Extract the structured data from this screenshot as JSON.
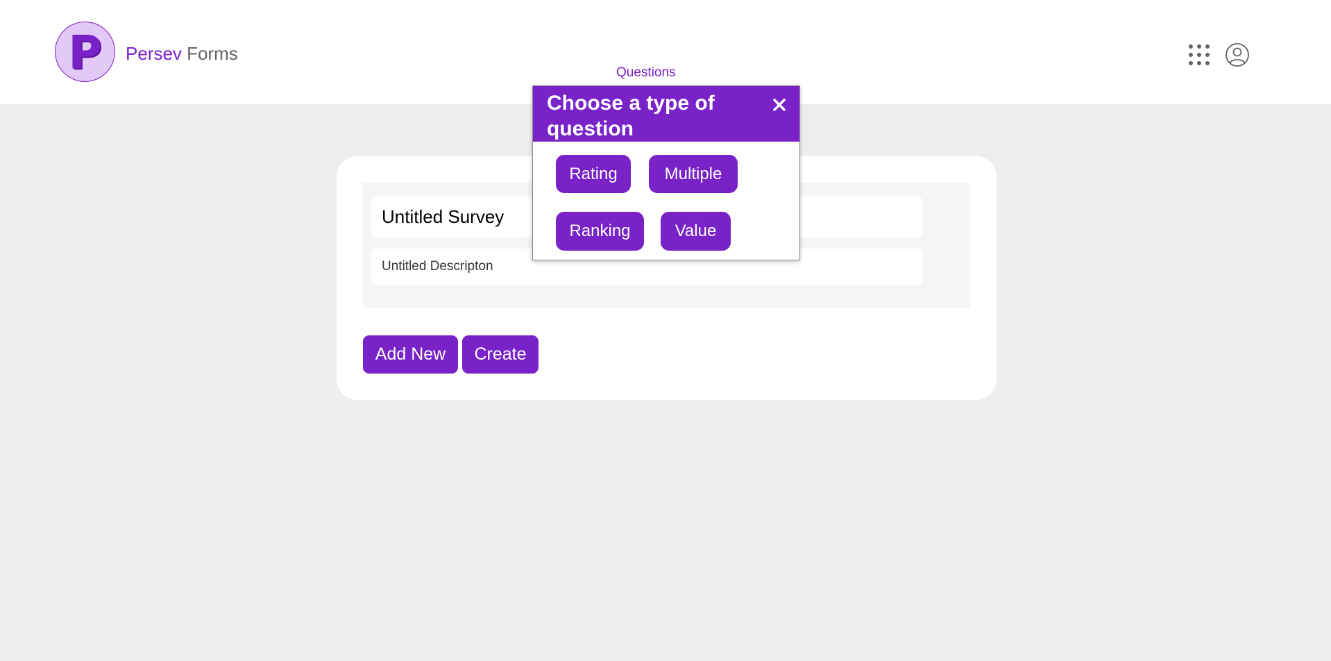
{
  "header": {
    "logo_letter": "P",
    "brand_name": "Persev",
    "brand_sub": "Forms",
    "nav_questions": "Questions",
    "icons": {
      "apps": "apps-grid-icon",
      "account": "account-circle-icon"
    }
  },
  "form": {
    "title": "Untitled Survey",
    "description": "Untitled Descripton",
    "add_new_label": "Add New",
    "create_label": "Create"
  },
  "modal": {
    "title": "Choose a type of question",
    "close_glyph": "×",
    "types": [
      "Rating",
      "Multiple",
      "Ranking",
      "Value"
    ]
  },
  "colors": {
    "accent": "#7822c8",
    "background": "#eeeeee",
    "card": "#ffffff",
    "logo_bg": "#e2c9f7",
    "muted_text": "#5f6368"
  }
}
